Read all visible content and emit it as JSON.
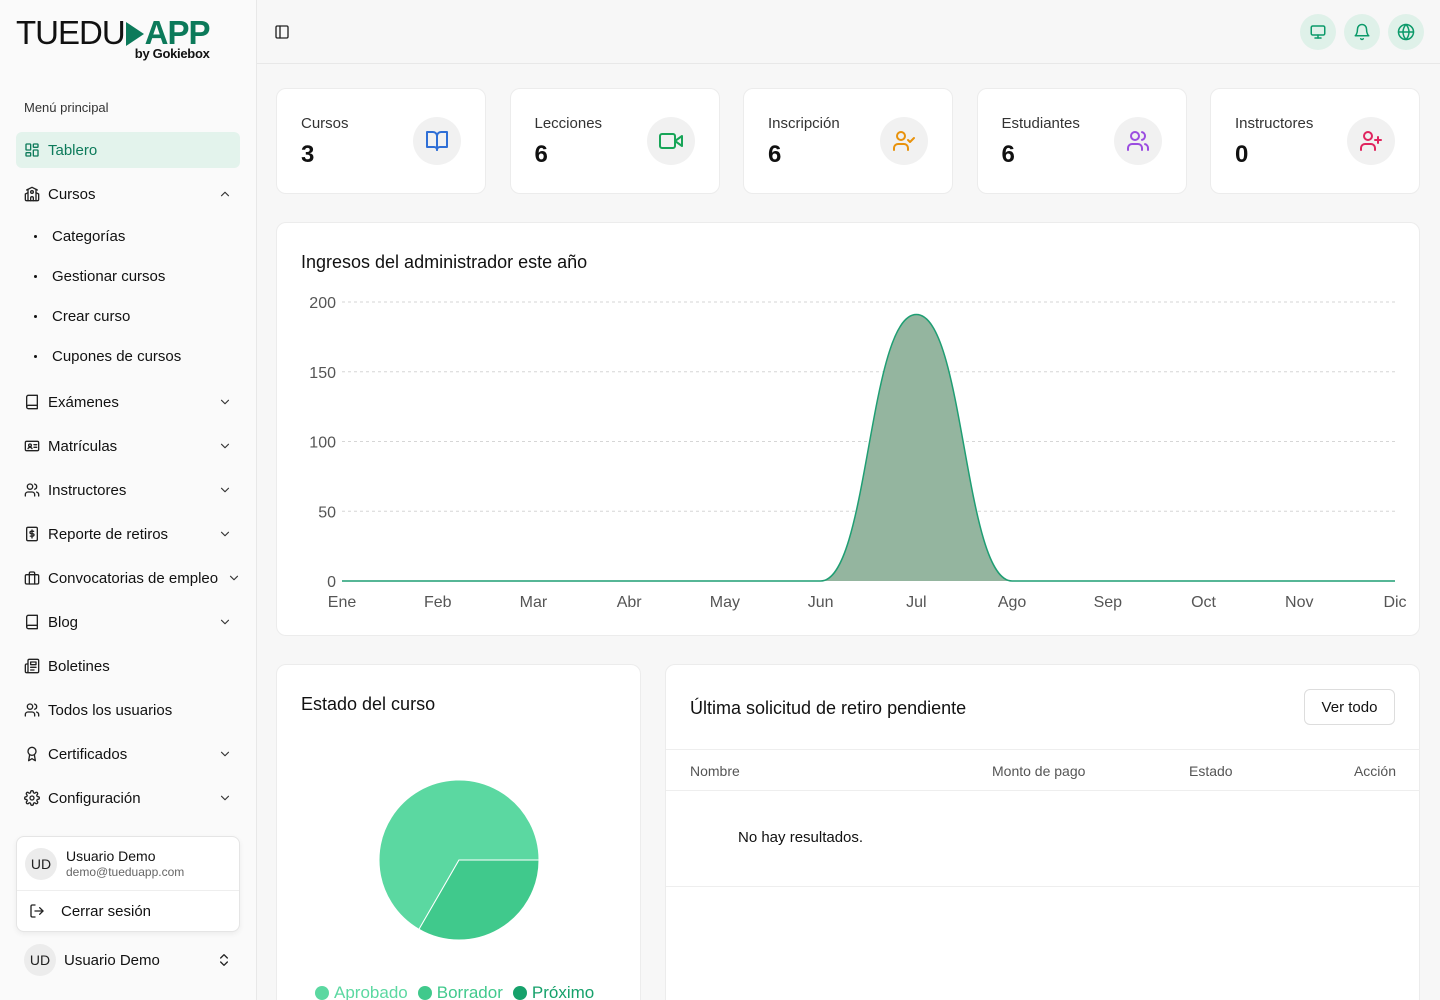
{
  "brand": {
    "name_left": "TUEDU",
    "name_right": "APP",
    "by": "by Gokiebox"
  },
  "sidebar": {
    "menu_title": "Menú principal",
    "items": [
      {
        "label": "Tablero",
        "icon": "dashboard-icon",
        "active": true
      },
      {
        "label": "Cursos",
        "icon": "school-icon",
        "expanded": true,
        "children": [
          "Categorías",
          "Gestionar cursos",
          "Crear curso",
          "Cupones de cursos"
        ]
      },
      {
        "label": "Exámenes",
        "icon": "book-icon"
      },
      {
        "label": "Matrículas",
        "icon": "id-card-icon"
      },
      {
        "label": "Instructores",
        "icon": "users-icon"
      },
      {
        "label": "Reporte de retiros",
        "icon": "receipt-dollar-icon"
      },
      {
        "label": "Convocatorias de empleo",
        "icon": "briefcase-icon"
      },
      {
        "label": "Blog",
        "icon": "book-icon"
      },
      {
        "label": "Boletines",
        "icon": "newspaper-icon"
      },
      {
        "label": "Todos los usuarios",
        "icon": "users-icon"
      },
      {
        "label": "Certificados",
        "icon": "award-icon"
      },
      {
        "label": "Configuración",
        "icon": "gear-icon"
      }
    ]
  },
  "user": {
    "initials": "UD",
    "name": "Usuario Demo",
    "email": "demo@tueduapp.com",
    "logout_label": "Cerrar sesión"
  },
  "stats": [
    {
      "label": "Cursos",
      "value": "3",
      "icon": "book-open-icon",
      "color": "#2f6fd6"
    },
    {
      "label": "Lecciones",
      "value": "6",
      "icon": "video-icon",
      "color": "#18a558"
    },
    {
      "label": "Inscripción",
      "value": "6",
      "icon": "user-check-icon",
      "color": "#e8920c"
    },
    {
      "label": "Estudiantes",
      "value": "6",
      "icon": "users-icon",
      "color": "#9b4de0"
    },
    {
      "label": "Instructores",
      "value": "0",
      "icon": "user-plus-icon",
      "color": "#e0245e"
    }
  ],
  "revenue": {
    "title": "Ingresos del administrador este año",
    "chart_data": {
      "type": "area",
      "categories": [
        "Ene",
        "Feb",
        "Mar",
        "Abr",
        "May",
        "Jun",
        "Jul",
        "Ago",
        "Sep",
        "Oct",
        "Nov",
        "Dic"
      ],
      "values": [
        0,
        0,
        0,
        0,
        0,
        0,
        191,
        0,
        0,
        0,
        0,
        0
      ],
      "yticks": [
        "0",
        "50",
        "100",
        "150",
        "200"
      ],
      "ylim": [
        0,
        200
      ],
      "grid": true,
      "fill_color": "#94b59f",
      "line_color": "#1f9e73"
    }
  },
  "course_status": {
    "title": "Estado del curso",
    "chart_data": {
      "type": "pie",
      "labels": [
        "Aprobado",
        "Borrador",
        "Próximo"
      ],
      "values": [
        2,
        1,
        0
      ],
      "colors": [
        "#5bd8a1",
        "#40c98c",
        "#16a16b"
      ],
      "legend": "bottom"
    }
  },
  "withdrawals": {
    "title": "Última solicitud de retiro pendiente",
    "view_all": "Ver todo",
    "columns": [
      "Nombre",
      "Monto de pago",
      "Estado",
      "Acción"
    ],
    "empty": "No hay resultados."
  }
}
